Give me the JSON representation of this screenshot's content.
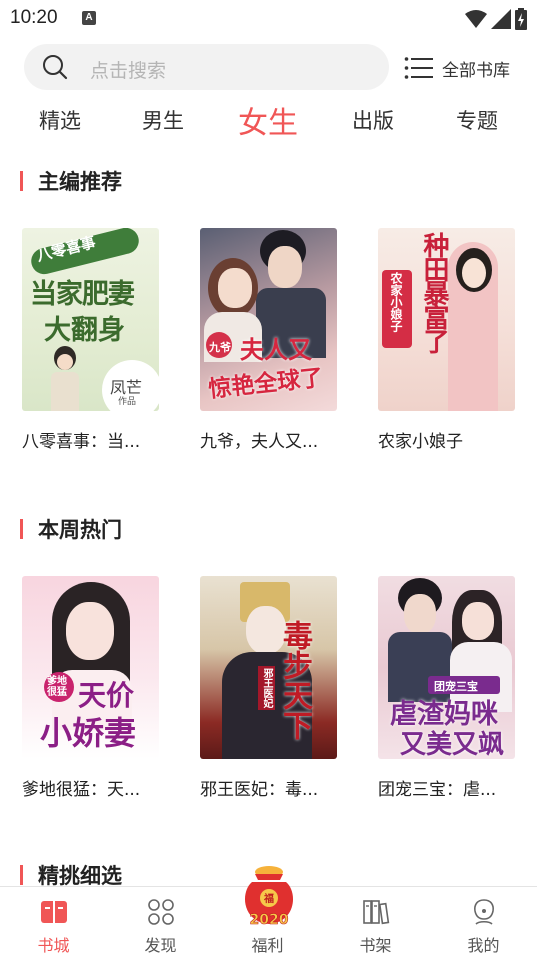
{
  "status": {
    "time": "10:20",
    "notification_icon": "A"
  },
  "search": {
    "placeholder": "点击搜索"
  },
  "library": {
    "label": "全部书库"
  },
  "tabs": [
    {
      "label": "精选"
    },
    {
      "label": "男生"
    },
    {
      "label": "女生",
      "active": true
    },
    {
      "label": "出版"
    },
    {
      "label": "专题"
    }
  ],
  "sections": [
    {
      "title": "主编推荐",
      "books": [
        {
          "title": "八零喜事：当...",
          "cover_texts": [
            "八零喜事",
            "当家肥妻",
            "大翻身",
            "凤芒",
            "作品"
          ]
        },
        {
          "title": "九爷，夫人又...",
          "cover_texts": [
            "九爷",
            "夫人又",
            "惊艳全球了"
          ]
        },
        {
          "title": "农家小娘子",
          "cover_texts": [
            "种田暴富了",
            "农家小娘子"
          ]
        }
      ]
    },
    {
      "title": "本周热门",
      "books": [
        {
          "title": "爹地很猛：天...",
          "cover_texts": [
            "爹地很猛",
            "天价",
            "小娇妻"
          ]
        },
        {
          "title": "邪王医妃：毒...",
          "cover_texts": [
            "毒步天下",
            "邪王医妃"
          ]
        },
        {
          "title": "团宠三宝：虐...",
          "cover_texts": [
            "团宠三宝",
            "虐渣妈咪",
            "又美又飒"
          ]
        }
      ]
    },
    {
      "title": "精挑细选"
    }
  ],
  "bottom_nav": [
    {
      "label": "书城",
      "icon": "book-city-icon",
      "active": true
    },
    {
      "label": "发现",
      "icon": "discover-icon"
    },
    {
      "label": "福利",
      "icon": "welfare-icon",
      "badge": "2020"
    },
    {
      "label": "书架",
      "icon": "bookshelf-icon"
    },
    {
      "label": "我的",
      "icon": "profile-icon"
    }
  ],
  "colors": {
    "accent": "#f05656",
    "text": "#222222",
    "muted": "#b5b5b5",
    "search_bg": "#f2f2f2"
  }
}
